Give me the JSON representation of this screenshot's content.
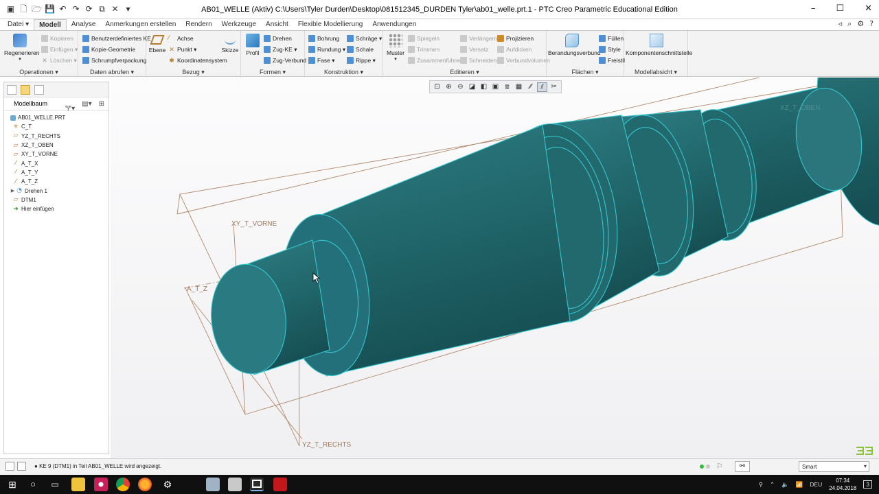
{
  "window": {
    "title": "AB01_WELLE (Aktiv) C:\\Users\\Tyler Durden\\Desktop\\081512345_DURDEN Tyler\\ab01_welle.prt.1 - PTC Creo Parametric Educational Edition"
  },
  "ribbon_tabs": [
    "Datei",
    "Modell",
    "Analyse",
    "Anmerkungen erstellen",
    "Rendern",
    "Werkzeuge",
    "Ansicht",
    "Flexible Modellierung",
    "Anwendungen"
  ],
  "active_tab": "Modell",
  "ribbon": {
    "operationen": {
      "label": "Operationen",
      "regenerieren": "Regenerieren",
      "kopieren": "Kopieren",
      "einfuegen": "Einfügen",
      "loeschen": "Löschen"
    },
    "daten_abrufen": {
      "label": "Daten abrufen",
      "benutzer_ke": "Benutzerdefiniertes KE",
      "kopie_geometrie": "Kopie-Geometrie",
      "schrumpf": "Schrumpfverpackung"
    },
    "bezug": {
      "label": "Bezug",
      "ebene": "Ebene",
      "achse": "Achse",
      "punkt": "Punkt",
      "koordinatensystem": "Koordinatensystem",
      "skizze": "Skizze"
    },
    "formen": {
      "label": "Formen",
      "profil": "Profil",
      "drehen": "Drehen",
      "zug_ke": "Zug-KE",
      "zug_verbund": "Zug-Verbund"
    },
    "konstruktion": {
      "label": "Konstruktion",
      "bohrung": "Bohrung",
      "rundung": "Rundung",
      "fase": "Fase",
      "schraege": "Schräge",
      "schale": "Schale",
      "rippe": "Rippe"
    },
    "editieren": {
      "label": "Editieren",
      "muster": "Muster",
      "spiegeln": "Spiegeln",
      "trimmen": "Trimmen",
      "zusammenfuehren": "Zusammenführen",
      "verlaengern": "Verlängern",
      "versatz": "Versatz",
      "schneiden": "Schneiden",
      "projizieren": "Projizieren",
      "aufdicken": "Aufdicken",
      "verbundvolumen": "Verbundvolumen"
    },
    "flaechen": {
      "label": "Flächen",
      "berandungsverbund": "Berandungsverbund",
      "fuellen": "Füllen",
      "style": "Style",
      "freistil": "Freistil"
    },
    "modellabsicht": {
      "label": "Modellabsicht",
      "komponentenschnittstelle": "Komponentenschnittstelle"
    }
  },
  "model_tree": {
    "title": "Modellbaum",
    "items": [
      {
        "label": "AB01_WELLE.PRT",
        "icon": "part-icon",
        "expandable": false
      },
      {
        "label": "C_T",
        "icon": "csys-icon",
        "expandable": false
      },
      {
        "label": "YZ_T_RECHTS",
        "icon": "plane-icon",
        "expandable": false
      },
      {
        "label": "XZ_T_OBEN",
        "icon": "plane-icon",
        "expandable": false
      },
      {
        "label": "XY_T_VORNE",
        "icon": "plane-icon",
        "expandable": false
      },
      {
        "label": "A_T_X",
        "icon": "axis-icon",
        "expandable": false
      },
      {
        "label": "A_T_Y",
        "icon": "axis-icon",
        "expandable": false
      },
      {
        "label": "A_T_Z",
        "icon": "axis-icon",
        "expandable": false
      },
      {
        "label": "Drehen 1",
        "icon": "revolve-icon",
        "expandable": true
      },
      {
        "label": "DTM1",
        "icon": "plane-icon",
        "expandable": false
      },
      {
        "label": "Hier einfügen",
        "icon": "insert-here-icon",
        "expandable": false
      }
    ]
  },
  "viewport": {
    "datum_labels": {
      "vorne": "XY_T_VORNE",
      "rechts": "YZ_T_RECHTS",
      "oben": "XZ_T_OBEN",
      "axis": "A_T_Z"
    },
    "colors": {
      "shaft_fill": "#236b70",
      "shaft_edge": "#35c6cf",
      "datum": "#9e7a5e"
    }
  },
  "status": {
    "message": "KE 9 (DTM1) in Teil AB01_WELLE wird angezeigt.",
    "filter": "Smart"
  },
  "taskbar": {
    "language": "DEU",
    "time": "07:34",
    "date": "24.04.2018",
    "notifications": "3"
  }
}
